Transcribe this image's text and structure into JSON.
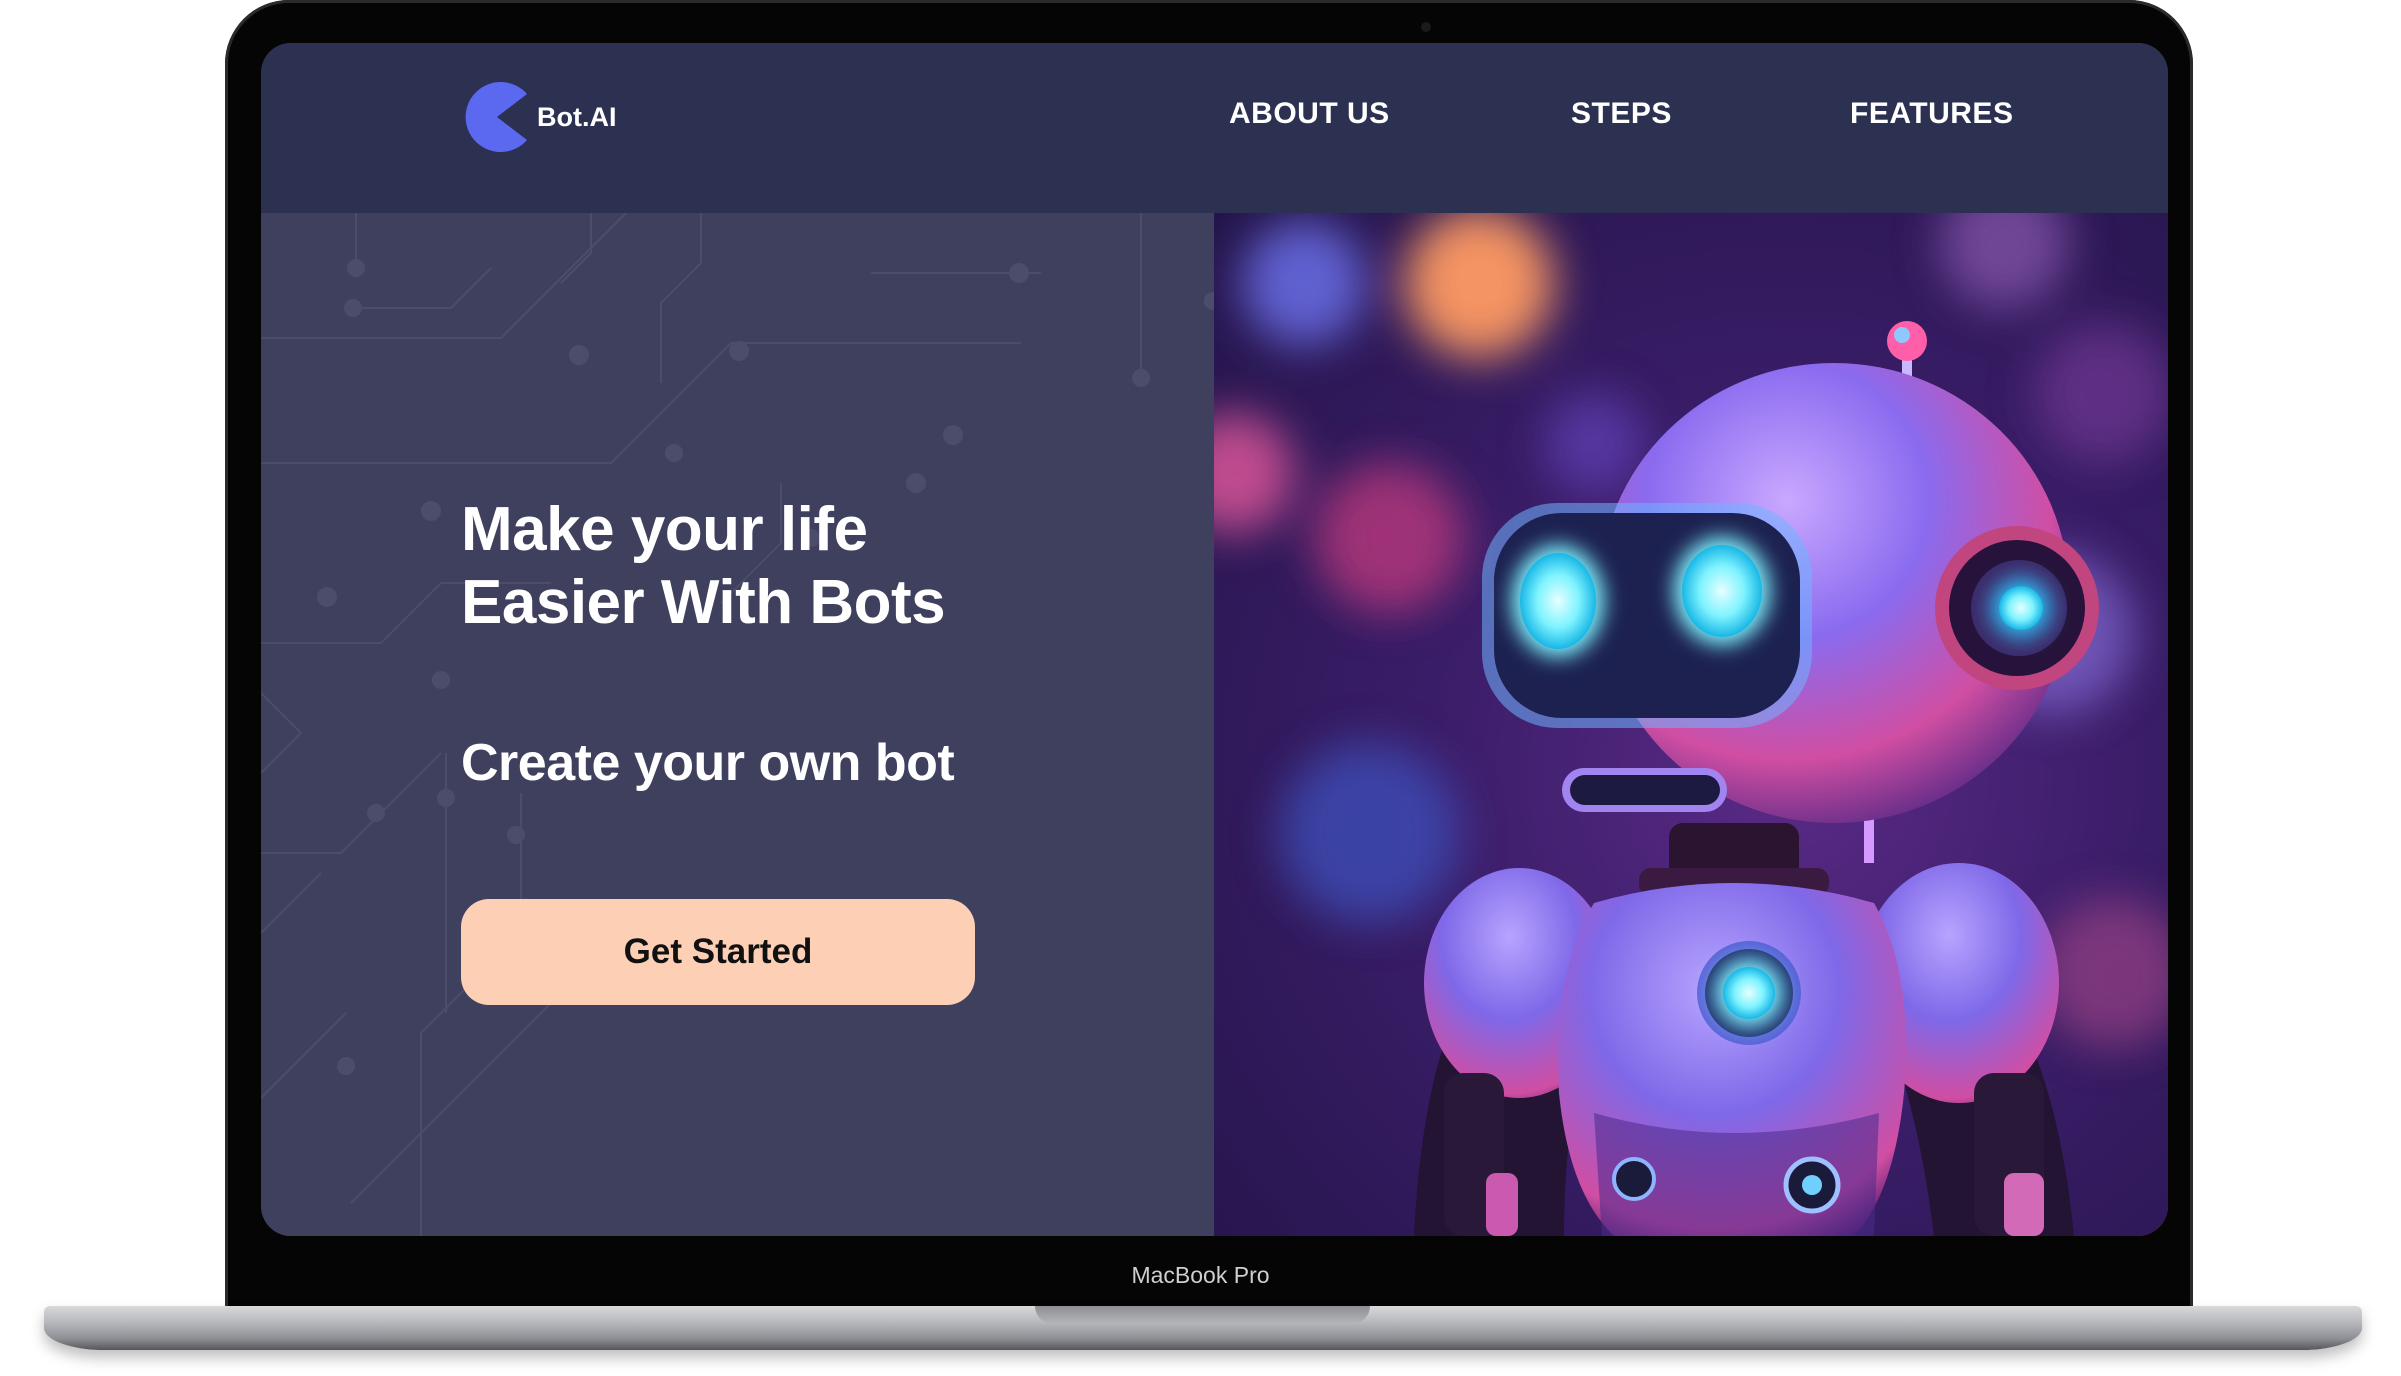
{
  "device": {
    "label": "MacBook Pro"
  },
  "site": {
    "logo_text": "Bot.AI",
    "nav": [
      {
        "label": "ABOUT US"
      },
      {
        "label": "STEPS"
      },
      {
        "label": "FEATURES"
      }
    ]
  },
  "hero": {
    "headline_line1": "Make your life",
    "headline_line2": "Easier With Bots",
    "subheadline": "Create your own bot",
    "cta_label": "Get Started"
  },
  "colors": {
    "navbar_bg": "#2c3152",
    "hero_bg": "#3f405e",
    "logo_accent": "#5b68f0",
    "cta_bg": "#fdd0b6",
    "text": "#ffffff"
  },
  "icons": {
    "logo": "pacman-logo-icon",
    "hero_image": "robot-illustration"
  }
}
